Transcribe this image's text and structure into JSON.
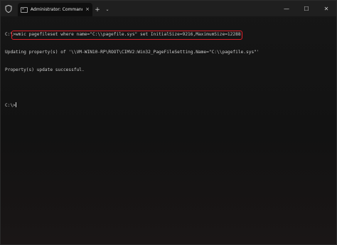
{
  "titlebar": {
    "tab_title": "Administrator: Command Prom",
    "tab_close": "×",
    "new_tab": "+",
    "dropdown": "⌄",
    "minimize": "—",
    "maximize": "☐",
    "close": "✕"
  },
  "terminal": {
    "prompt1": "C:\\",
    "command": ">wmic pagefileset where name=\"C:\\\\pagefile.sys\" set InitialSize=9216,MaximumSize=12288",
    "output1": "Updating property(s) of '\\\\VM-WIN10-RP\\ROOT\\CIMV2:Win32_PageFileSetting.Name=\"C:\\\\pagefile.sys\"'",
    "output2": "Property(s) update successful.",
    "prompt2": "C:\\>"
  },
  "colors": {
    "highlight": "#e0202a",
    "text": "#cccccc",
    "background": "#0c0c0c"
  }
}
